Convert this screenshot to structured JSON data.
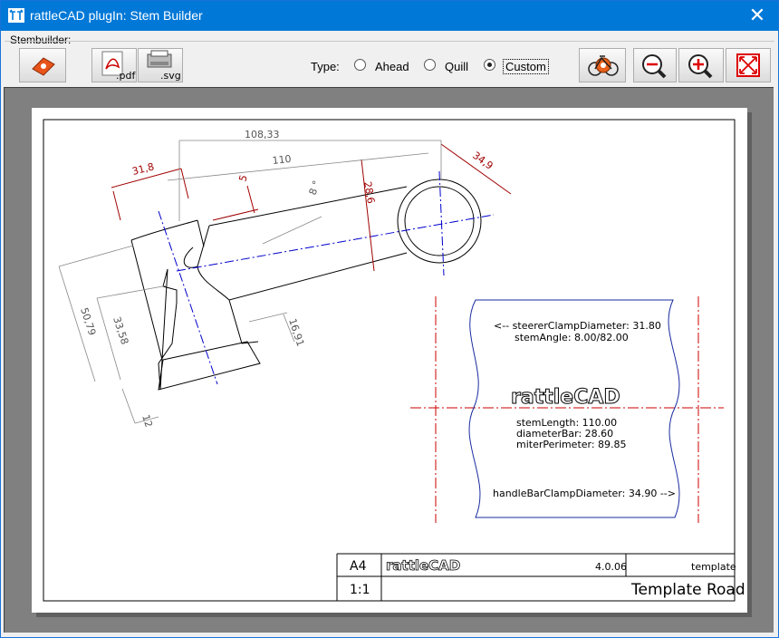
{
  "window": {
    "title": "rattleCAD plugIn: Stem Builder",
    "close_glyph": "✕"
  },
  "menu": {
    "label": "Stembuilder:"
  },
  "toolbar": {
    "pdf_label": ".pdf",
    "svg_label": ".svg",
    "type_label": "Type:",
    "types": [
      {
        "label": "Ahead",
        "selected": false
      },
      {
        "label": "Quill",
        "selected": false
      },
      {
        "label": "Custom",
        "selected": true
      }
    ]
  },
  "drawing": {
    "dims": {
      "d108": "108,33",
      "d110": "110",
      "d31_8": "31,8",
      "d5": "5",
      "d8deg": "8 °",
      "d28_6": "28,6",
      "d34_9": "34,9",
      "d50_79": "50,79",
      "d33_58": "33,58",
      "d16_91": "16,91",
      "d12": "12"
    },
    "info": {
      "steerer": "<-- steererClampDiameter: 31.80",
      "angle": "stemAngle: 8.00/82.00",
      "logo": "rattleCAD",
      "length": "stemLength: 110.00",
      "diameter": "diameterBar: 28.60",
      "miter": "miterPerimeter: 89.85",
      "handlebar": "handleBarClampDiameter: 34.90 -->"
    },
    "titleblock": {
      "format": "A4",
      "logo": "rattleCAD",
      "version": "4.0.06",
      "template": "template",
      "scale": "1:1",
      "name": "Template Road"
    }
  },
  "colors": {
    "accent": "#0078d7",
    "dimension": "#a00000",
    "centerline": "#0000cc",
    "dashdot": "#cc0000"
  }
}
